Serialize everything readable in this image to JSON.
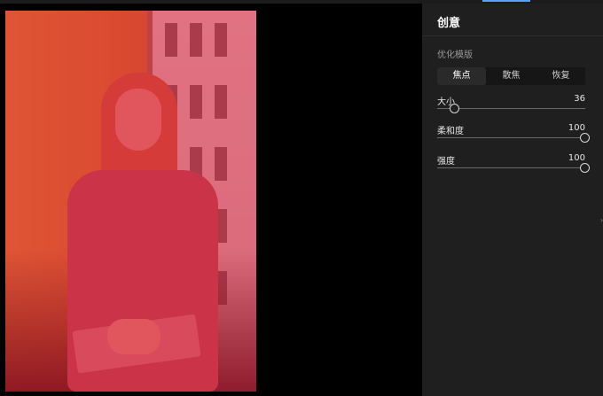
{
  "panel": {
    "title": "创意",
    "section_label": "优化模版",
    "modes": [
      {
        "label": "焦点",
        "active": true
      },
      {
        "label": "散焦",
        "active": false
      },
      {
        "label": "恢复",
        "active": false
      }
    ],
    "sliders": [
      {
        "label": "大小",
        "value": "36",
        "fraction": 0.09
      },
      {
        "label": "柔和度",
        "value": "100",
        "fraction": 1.0
      },
      {
        "label": "强度",
        "value": "100",
        "fraction": 1.0
      }
    ]
  },
  "colors": {
    "accent": "#5aa0ff",
    "mask_overlay": "#dc1437",
    "panel_bg": "#1f1f1f"
  }
}
